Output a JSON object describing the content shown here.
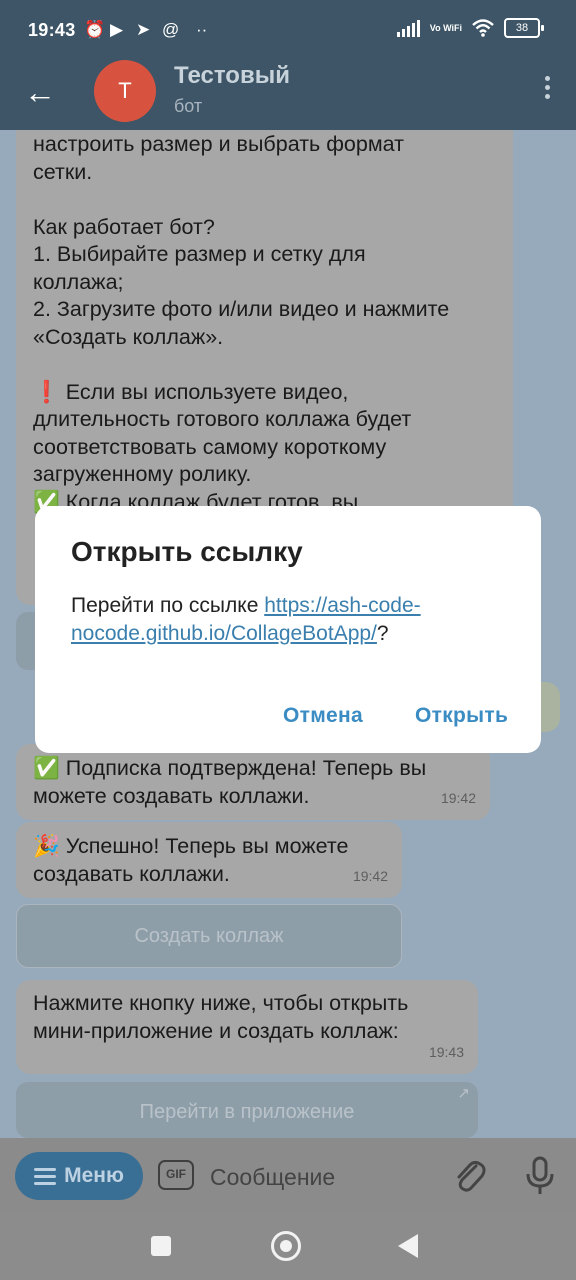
{
  "status_bar": {
    "time": "19:43",
    "vowifi": "Vo WiFi",
    "battery": "38"
  },
  "header": {
    "avatar_letter": "Т",
    "title": "Тестовый",
    "subtitle": "бот"
  },
  "messages": {
    "long": {
      "lines": [
        "настроить размер и выбрать формат",
        "сетки.",
        "",
        "Как работает бот?",
        "1. Выбирайте размер и сетку для",
        "коллажа;",
        "2. Загрузите фото и/или видео и нажмите",
        "«Создать коллаж».",
        "",
        "❗ Если вы используете видео,",
        "длительность готового коллажа будет",
        "соответствовать самому короткому",
        "загруженному ролику.",
        "✅ Когда коллаж будет готов, вы"
      ]
    },
    "sub_confirmed": {
      "text": "✅ Подписка подтверждена! Теперь вы можете создавать коллажи.",
      "time": "19:42"
    },
    "success": {
      "text": "🎉 Успешно! Теперь вы можете создавать коллажи.",
      "time": "19:42"
    },
    "create_button": "Создать коллаж",
    "open_app_msg": {
      "text": "Нажмите кнопку ниже, чтобы открыть мини-приложение и создать коллаж:",
      "time": "19:43"
    },
    "open_app_button": "Перейти в приложение"
  },
  "input_bar": {
    "menu_label": "Меню",
    "gif_label": "GIF",
    "placeholder": "Сообщение"
  },
  "dialog": {
    "title": "Открыть ссылку",
    "body_prefix": "Перейти по ссылке ",
    "link": "https://ash-code-nocode.github.io/CollageBotApp/",
    "body_suffix": "?",
    "cancel": "Отмена",
    "open": "Открыть"
  },
  "colors": {
    "header_bg": "#3d5566",
    "accent": "#3a8cc3",
    "avatar": "#d8533f"
  }
}
